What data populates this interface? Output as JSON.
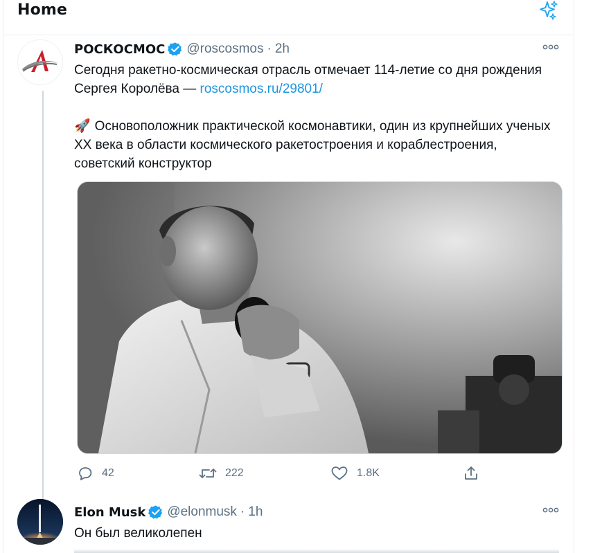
{
  "header": {
    "title": "Home",
    "icon": "sparkle-icon",
    "accent": "#1da1f2"
  },
  "tweets": [
    {
      "display_name": "РОСКОСМОС",
      "verified": true,
      "handle": "@roscosmos",
      "separator": "·",
      "time": "2h",
      "text_line1_prefix": "Сегодня ракетно-космическая отрасль отмечает 114-летие со дня рождения Сергея Королёва — ",
      "link": "roscosmos.ru/29801/",
      "text_emoji": "🚀",
      "text_para2": "Основоположник практической космонавтики, один из крупнейших ученых XX века в области космического ракетостроения и кораблестроения, советский конструктор",
      "media": {
        "kind": "black-and-white photo",
        "icon": "photo"
      },
      "actions": {
        "replies": "42",
        "retweets": "222",
        "likes": "1.8K"
      }
    },
    {
      "display_name": "Elon Musk",
      "verified": true,
      "handle": "@elonmusk",
      "separator": "·",
      "time": "1h",
      "text": "Он был великолепен"
    }
  ],
  "colors": {
    "link": "#1b95e0",
    "muted": "#5b7083",
    "verified": "#1da1f2",
    "border": "#ebeef0"
  }
}
